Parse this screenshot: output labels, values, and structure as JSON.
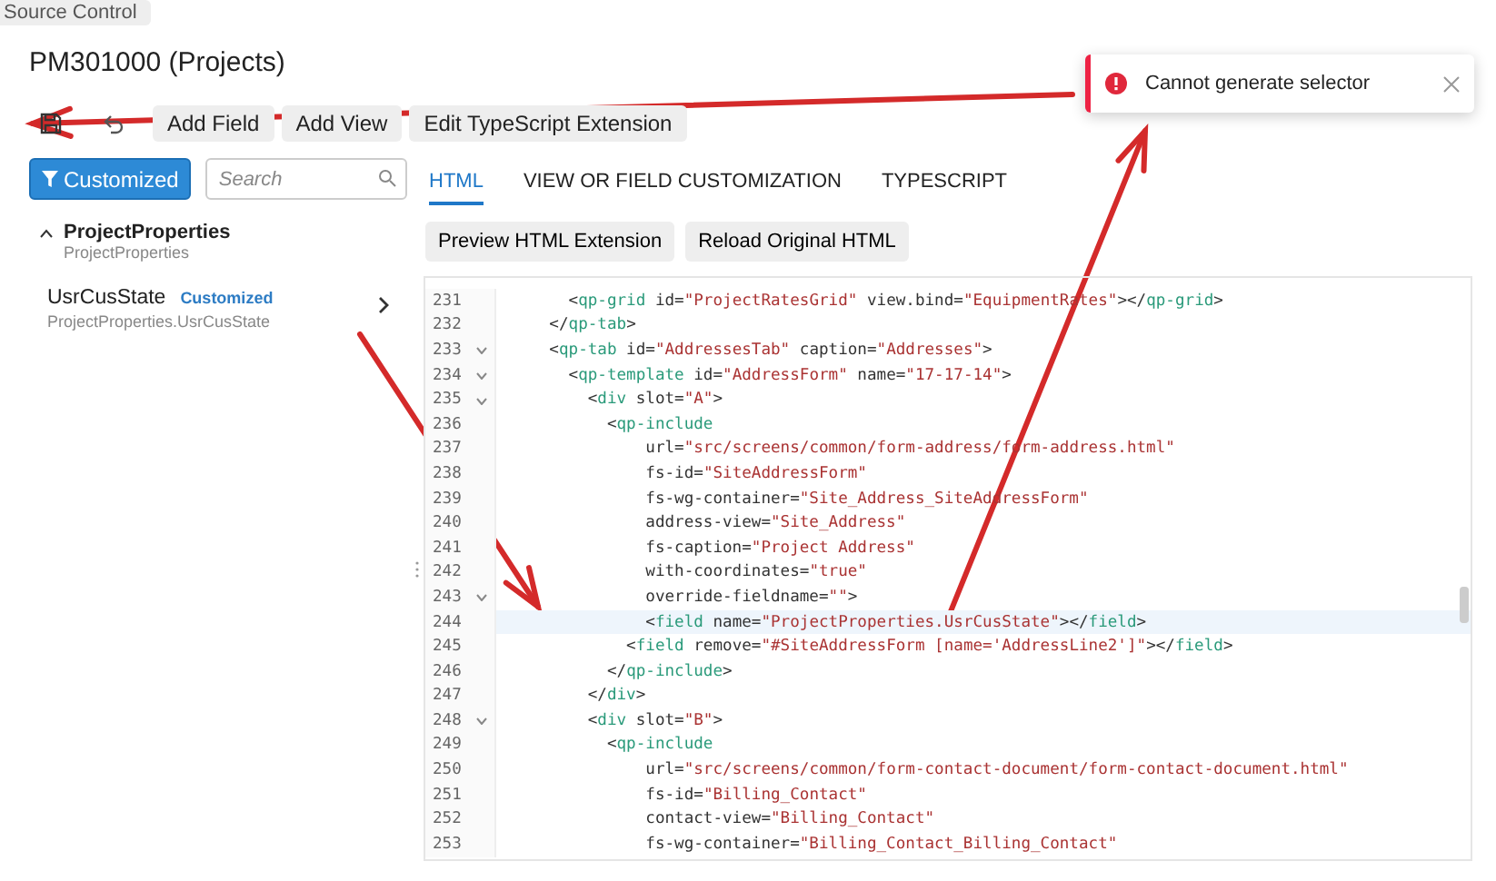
{
  "top_tab": {
    "label": "Source Control"
  },
  "title": "PM301000 (Projects)",
  "toolbar": {
    "buttons": [
      "Add Field",
      "Add View",
      "Edit TypeScript Extension"
    ]
  },
  "sidebar": {
    "filter_button": "Customized",
    "search": {
      "placeholder": "Search"
    },
    "tree": [
      {
        "name": "ProjectProperties",
        "path": "ProjectProperties",
        "expanded": true,
        "children": [
          {
            "name": "UsrCusState",
            "badge": "Customized",
            "path": "ProjectProperties.UsrCusState"
          }
        ]
      }
    ]
  },
  "tabs": [
    {
      "label": "HTML",
      "selected": true
    },
    {
      "label": "VIEW OR FIELD CUSTOMIZATION",
      "selected": false
    },
    {
      "label": "TYPESCRIPT",
      "selected": false
    }
  ],
  "editor_buttons": [
    "Preview HTML Extension",
    "Reload Original HTML"
  ],
  "code_lines": [
    {
      "number": "231",
      "foldable": false,
      "current": false,
      "tokens": [
        {
          "kind": "punct",
          "text": "      <"
        },
        {
          "kind": "tag",
          "text": "qp-grid"
        },
        {
          "kind": "attr",
          "text": " id="
        },
        {
          "kind": "value",
          "text": "\"ProjectRatesGrid\""
        },
        {
          "kind": "attr",
          "text": " view.bind="
        },
        {
          "kind": "value",
          "text": "\"EquipmentRates\""
        },
        {
          "kind": "punct",
          "text": "></"
        },
        {
          "kind": "tag",
          "text": "qp-grid"
        },
        {
          "kind": "punct",
          "text": ">"
        }
      ]
    },
    {
      "number": "232",
      "foldable": false,
      "current": false,
      "tokens": [
        {
          "kind": "punct",
          "text": "    </"
        },
        {
          "kind": "tag",
          "text": "qp-tab"
        },
        {
          "kind": "punct",
          "text": ">"
        }
      ]
    },
    {
      "number": "233",
      "foldable": true,
      "current": false,
      "tokens": [
        {
          "kind": "punct",
          "text": "    <"
        },
        {
          "kind": "tag",
          "text": "qp-tab"
        },
        {
          "kind": "attr",
          "text": " id="
        },
        {
          "kind": "value",
          "text": "\"AddressesTab\""
        },
        {
          "kind": "attr",
          "text": " caption="
        },
        {
          "kind": "value",
          "text": "\"Addresses\""
        },
        {
          "kind": "punct",
          "text": ">"
        }
      ]
    },
    {
      "number": "234",
      "foldable": true,
      "current": false,
      "tokens": [
        {
          "kind": "punct",
          "text": "      <"
        },
        {
          "kind": "tag",
          "text": "qp-template"
        },
        {
          "kind": "attr",
          "text": " id="
        },
        {
          "kind": "value",
          "text": "\"AddressForm\""
        },
        {
          "kind": "attr",
          "text": " name="
        },
        {
          "kind": "value",
          "text": "\"17-17-14\""
        },
        {
          "kind": "punct",
          "text": ">"
        }
      ]
    },
    {
      "number": "235",
      "foldable": true,
      "current": false,
      "tokens": [
        {
          "kind": "punct",
          "text": "        <"
        },
        {
          "kind": "tag",
          "text": "div"
        },
        {
          "kind": "attr",
          "text": " slot="
        },
        {
          "kind": "value",
          "text": "\"A\""
        },
        {
          "kind": "punct",
          "text": ">"
        }
      ]
    },
    {
      "number": "236",
      "foldable": false,
      "current": false,
      "tokens": [
        {
          "kind": "punct",
          "text": "          <"
        },
        {
          "kind": "tag",
          "text": "qp-include"
        }
      ]
    },
    {
      "number": "237",
      "foldable": false,
      "current": false,
      "tokens": [
        {
          "kind": "attr",
          "text": "              url="
        },
        {
          "kind": "value",
          "text": "\"src/screens/common/form-address/form-address.html\""
        }
      ]
    },
    {
      "number": "238",
      "foldable": false,
      "current": false,
      "tokens": [
        {
          "kind": "attr",
          "text": "              fs-id="
        },
        {
          "kind": "value",
          "text": "\"SiteAddressForm\""
        }
      ]
    },
    {
      "number": "239",
      "foldable": false,
      "current": false,
      "tokens": [
        {
          "kind": "attr",
          "text": "              fs-wg-container="
        },
        {
          "kind": "value",
          "text": "\"Site_Address_SiteAddressForm\""
        }
      ]
    },
    {
      "number": "240",
      "foldable": false,
      "current": false,
      "tokens": [
        {
          "kind": "attr",
          "text": "              address-view="
        },
        {
          "kind": "value",
          "text": "\"Site_Address\""
        }
      ]
    },
    {
      "number": "241",
      "foldable": false,
      "current": false,
      "tokens": [
        {
          "kind": "attr",
          "text": "              fs-caption="
        },
        {
          "kind": "value",
          "text": "\"Project Address\""
        }
      ]
    },
    {
      "number": "242",
      "foldable": false,
      "current": false,
      "tokens": [
        {
          "kind": "attr",
          "text": "              with-coordinates="
        },
        {
          "kind": "value",
          "text": "\"true\""
        }
      ]
    },
    {
      "number": "243",
      "foldable": true,
      "current": false,
      "tokens": [
        {
          "kind": "attr",
          "text": "              override-fieldname="
        },
        {
          "kind": "value",
          "text": "\"\""
        },
        {
          "kind": "punct",
          "text": ">"
        }
      ]
    },
    {
      "number": "244",
      "foldable": false,
      "current": true,
      "tokens": [
        {
          "kind": "punct",
          "text": "              <"
        },
        {
          "kind": "tag",
          "text": "field"
        },
        {
          "kind": "attr",
          "text": " name="
        },
        {
          "kind": "value",
          "text": "\"ProjectProperties.UsrCusState\""
        },
        {
          "kind": "punct",
          "text": "></"
        },
        {
          "kind": "tag",
          "text": "field"
        },
        {
          "kind": "punct",
          "text": ">"
        }
      ]
    },
    {
      "number": "245",
      "foldable": false,
      "current": false,
      "tokens": [
        {
          "kind": "punct",
          "text": "            <"
        },
        {
          "kind": "tag",
          "text": "field"
        },
        {
          "kind": "attr",
          "text": " remove="
        },
        {
          "kind": "value",
          "text": "\"#SiteAddressForm [name='AddressLine2']\""
        },
        {
          "kind": "punct",
          "text": "></"
        },
        {
          "kind": "tag",
          "text": "field"
        },
        {
          "kind": "punct",
          "text": ">"
        }
      ]
    },
    {
      "number": "246",
      "foldable": false,
      "current": false,
      "tokens": [
        {
          "kind": "punct",
          "text": "          </"
        },
        {
          "kind": "tag",
          "text": "qp-include"
        },
        {
          "kind": "punct",
          "text": ">"
        }
      ]
    },
    {
      "number": "247",
      "foldable": false,
      "current": false,
      "tokens": [
        {
          "kind": "punct",
          "text": "        </"
        },
        {
          "kind": "tag",
          "text": "div"
        },
        {
          "kind": "punct",
          "text": ">"
        }
      ]
    },
    {
      "number": "248",
      "foldable": true,
      "current": false,
      "tokens": [
        {
          "kind": "punct",
          "text": "        <"
        },
        {
          "kind": "tag",
          "text": "div"
        },
        {
          "kind": "attr",
          "text": " slot="
        },
        {
          "kind": "value",
          "text": "\"B\""
        },
        {
          "kind": "punct",
          "text": ">"
        }
      ]
    },
    {
      "number": "249",
      "foldable": false,
      "current": false,
      "tokens": [
        {
          "kind": "punct",
          "text": "          <"
        },
        {
          "kind": "tag",
          "text": "qp-include"
        }
      ]
    },
    {
      "number": "250",
      "foldable": false,
      "current": false,
      "tokens": [
        {
          "kind": "attr",
          "text": "              url="
        },
        {
          "kind": "value",
          "text": "\"src/screens/common/form-contact-document/form-contact-document.html\""
        }
      ]
    },
    {
      "number": "251",
      "foldable": false,
      "current": false,
      "tokens": [
        {
          "kind": "attr",
          "text": "              fs-id="
        },
        {
          "kind": "value",
          "text": "\"Billing_Contact\""
        }
      ]
    },
    {
      "number": "252",
      "foldable": false,
      "current": false,
      "tokens": [
        {
          "kind": "attr",
          "text": "              contact-view="
        },
        {
          "kind": "value",
          "text": "\"Billing_Contact\""
        }
      ]
    },
    {
      "number": "253",
      "foldable": false,
      "current": false,
      "tokens": [
        {
          "kind": "attr",
          "text": "              fs-wg-container="
        },
        {
          "kind": "value",
          "text": "\"Billing_Contact_Billing_Contact\""
        }
      ]
    }
  ],
  "toast": {
    "kind": "error",
    "message": "Cannot generate selector"
  },
  "annotations": [
    {
      "kind": "arrow"
    },
    {
      "kind": "arrow"
    },
    {
      "kind": "arrow"
    }
  ]
}
